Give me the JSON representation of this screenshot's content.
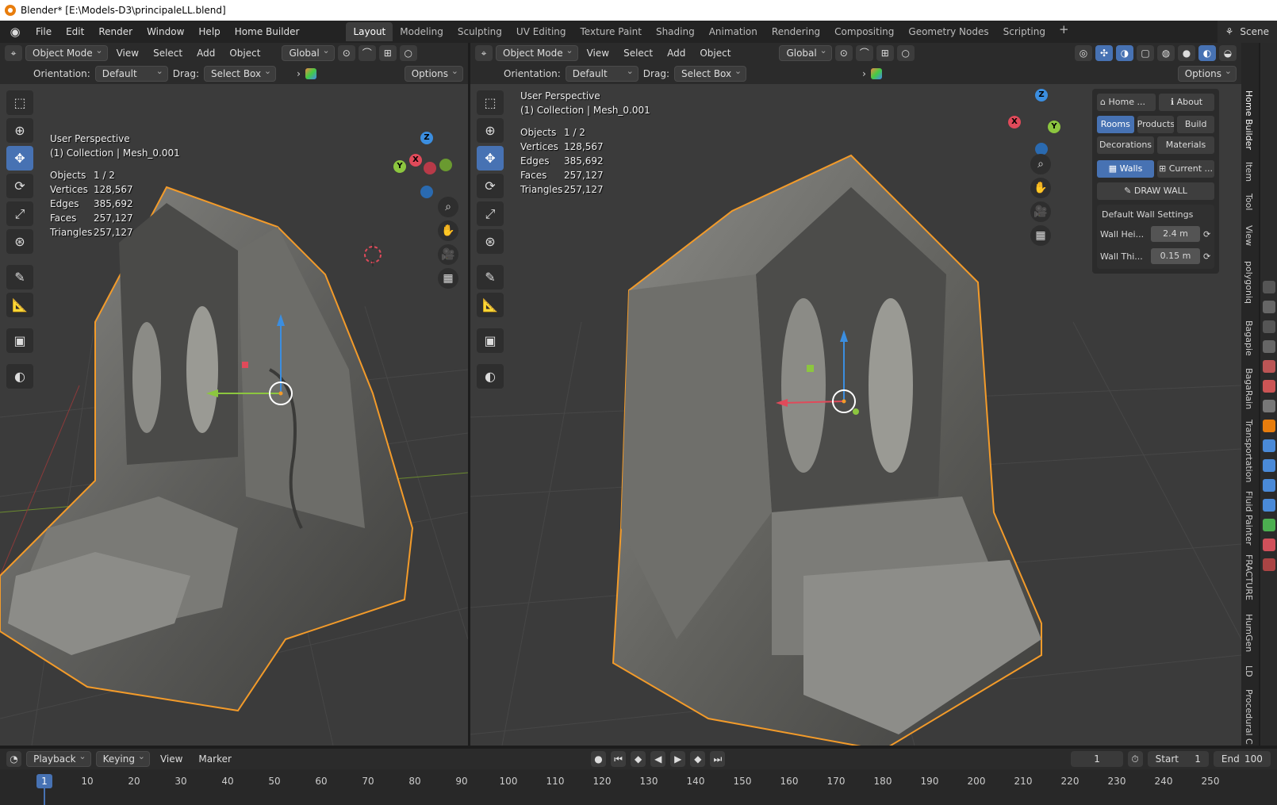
{
  "window": {
    "title": "Blender* [E:\\Models-D3\\principaleLL.blend]"
  },
  "menubar": {
    "menus": [
      "File",
      "Edit",
      "Render",
      "Window",
      "Help",
      "Home Builder"
    ],
    "workspaces": [
      "Layout",
      "Modeling",
      "Sculpting",
      "UV Editing",
      "Texture Paint",
      "Shading",
      "Animation",
      "Rendering",
      "Compositing",
      "Geometry Nodes",
      "Scripting"
    ],
    "active_workspace": "Layout",
    "scene": "Scene"
  },
  "viewport_left": {
    "mode": "Object Mode",
    "menus": [
      "View",
      "Select",
      "Add",
      "Object"
    ],
    "transform_orientation": "Global",
    "orientation_label": "Orientation:",
    "orientation_value": "Default",
    "drag_label": "Drag:",
    "drag_value": "Select Box",
    "options": "Options",
    "perspective": "User Perspective",
    "collection": "(1) Collection | Mesh_0.001",
    "stats": [
      {
        "k": "Objects",
        "v": "1 / 2"
      },
      {
        "k": "Vertices",
        "v": "128,567"
      },
      {
        "k": "Edges",
        "v": "385,692"
      },
      {
        "k": "Faces",
        "v": "257,127"
      },
      {
        "k": "Triangles",
        "v": "257,127"
      }
    ]
  },
  "viewport_right": {
    "mode": "Object Mode",
    "menus": [
      "View",
      "Select",
      "Add",
      "Object"
    ],
    "transform_orientation": "Global",
    "orientation_label": "Orientation:",
    "orientation_value": "Default",
    "drag_label": "Drag:",
    "drag_value": "Select Box",
    "options": "Options",
    "perspective": "User Perspective",
    "collection": "(1) Collection | Mesh_0.001",
    "stats": [
      {
        "k": "Objects",
        "v": "1 / 2"
      },
      {
        "k": "Vertices",
        "v": "128,567"
      },
      {
        "k": "Edges",
        "v": "385,692"
      },
      {
        "k": "Faces",
        "v": "257,127"
      },
      {
        "k": "Triangles",
        "v": "257,127"
      }
    ]
  },
  "home_builder": {
    "home": "Home ...",
    "about": "About",
    "tabs": [
      "Rooms",
      "Products",
      "Build"
    ],
    "tabs2": [
      "Decorations",
      "Materials"
    ],
    "walls": "Walls",
    "current": "Current ...",
    "draw_wall": "DRAW WALL",
    "settings_title": "Default Wall Settings",
    "wall_height_label": "Wall Hei...",
    "wall_height": "2.4 m",
    "wall_thickness_label": "Wall Thi...",
    "wall_thickness": "0.15 m"
  },
  "side_tabs": [
    "Home Builder",
    "Item",
    "Tool",
    "View",
    "polygoniq",
    "Bagapie",
    "BagaRain",
    "Transportation",
    "Fluid Painter",
    "FRACTURE",
    "HumGen",
    "LD",
    "Procedural C"
  ],
  "axes": {
    "x": "X",
    "y": "Y",
    "z": "Z"
  },
  "timeline": {
    "menus": [
      "Playback",
      "Keying",
      "View",
      "Marker"
    ],
    "current_frame": "1",
    "start_label": "Start",
    "start": "1",
    "end_label": "End",
    "end": "100",
    "ruler": [
      "1",
      "10",
      "20",
      "30",
      "40",
      "50",
      "60",
      "70",
      "80",
      "90",
      "100",
      "110",
      "120",
      "130",
      "140",
      "150",
      "160",
      "170",
      "180",
      "190",
      "200",
      "210",
      "220",
      "230",
      "240",
      "250"
    ]
  },
  "colors": {
    "accent": "#4772b3",
    "outline": "#f39b2a",
    "x_axis": "#e04a5a",
    "y_axis": "#8cc63f",
    "z_axis": "#3b8ee0"
  }
}
